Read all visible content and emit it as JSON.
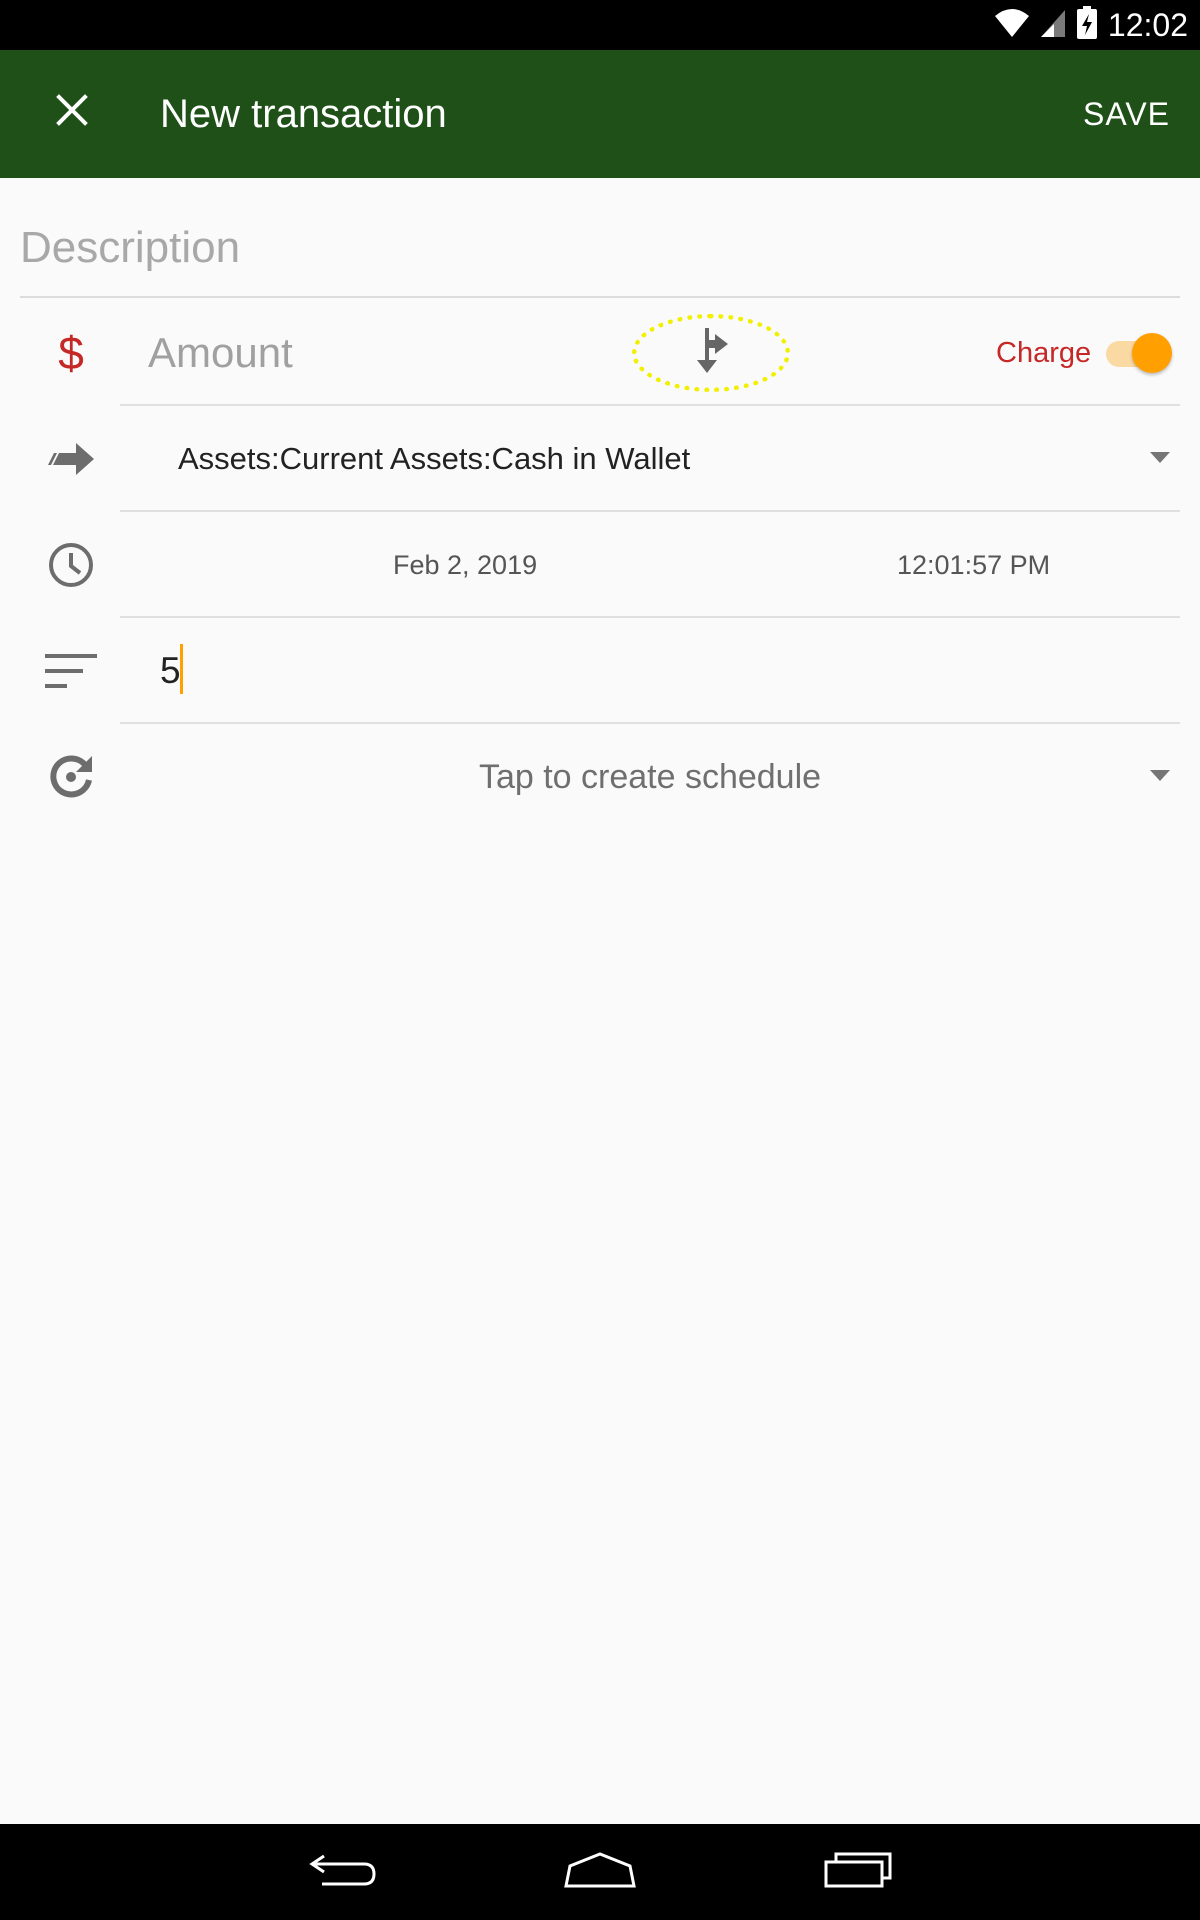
{
  "status_bar": {
    "time": "12:02",
    "icons": [
      "wifi-icon",
      "signal-icon",
      "battery-charging-icon"
    ]
  },
  "app_bar": {
    "close_icon": "close-icon",
    "title": "New transaction",
    "save_label": "SAVE",
    "background_color": "#1e5018"
  },
  "form": {
    "description": {
      "placeholder": "Description",
      "value": ""
    },
    "amount": {
      "currency_symbol": "$",
      "placeholder": "Amount",
      "value": "",
      "split_icon": "split-transaction-icon",
      "charge_label": "Charge",
      "charge_enabled": true
    },
    "account": {
      "icon": "transfer-arrow-icon",
      "value": "Assets:Current Assets:Cash in Wallet"
    },
    "datetime": {
      "icon": "clock-icon",
      "date": "Feb 2, 2019",
      "time": "12:01:57 PM"
    },
    "notes": {
      "icon": "notes-icon",
      "value": "5"
    },
    "schedule": {
      "icon": "recurrence-icon",
      "label": "Tap to create schedule"
    }
  },
  "colors": {
    "accent": "#ffa000",
    "charge": "#c62828",
    "highlight": "#f0f000"
  },
  "nav_bar": {
    "buttons": [
      "back-icon",
      "home-icon",
      "recent-apps-icon"
    ]
  }
}
